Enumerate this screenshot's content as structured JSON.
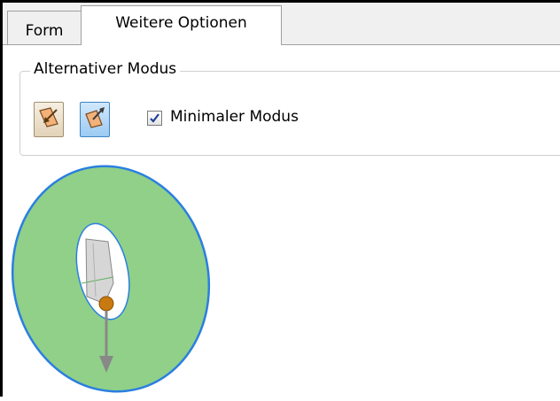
{
  "tabs": [
    {
      "label": "Form",
      "active": false
    },
    {
      "label": "Weitere Optionen",
      "active": true
    }
  ],
  "group": {
    "title": "Alternativer Modus",
    "buttons": [
      {
        "icon": "face-arrow-in-icon",
        "pressed": false
      },
      {
        "icon": "face-arrow-out-icon",
        "pressed": true
      }
    ],
    "checkbox": {
      "label": "Minimaler Modus",
      "checked": true
    }
  },
  "preview": {
    "shape": "annular-face-preview",
    "face_color": "#90d088",
    "edge_color": "#2a7fe0",
    "icon": "direction-arrow-icon"
  }
}
